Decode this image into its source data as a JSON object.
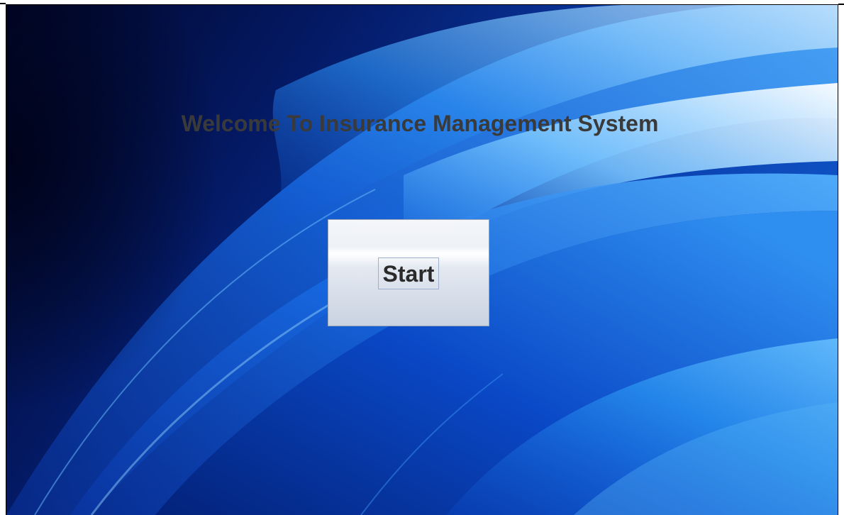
{
  "window": {
    "title": "Welcome To Insurance Management System"
  },
  "start_button": {
    "label": "Start"
  },
  "colors": {
    "title_text": "#3a3a3a",
    "background_dark": "#030d3a",
    "background_accent": "#1d6fd8",
    "button_face": "#e4e9f1"
  },
  "icons": {
    "background": "blue-swirl-wallpaper"
  }
}
